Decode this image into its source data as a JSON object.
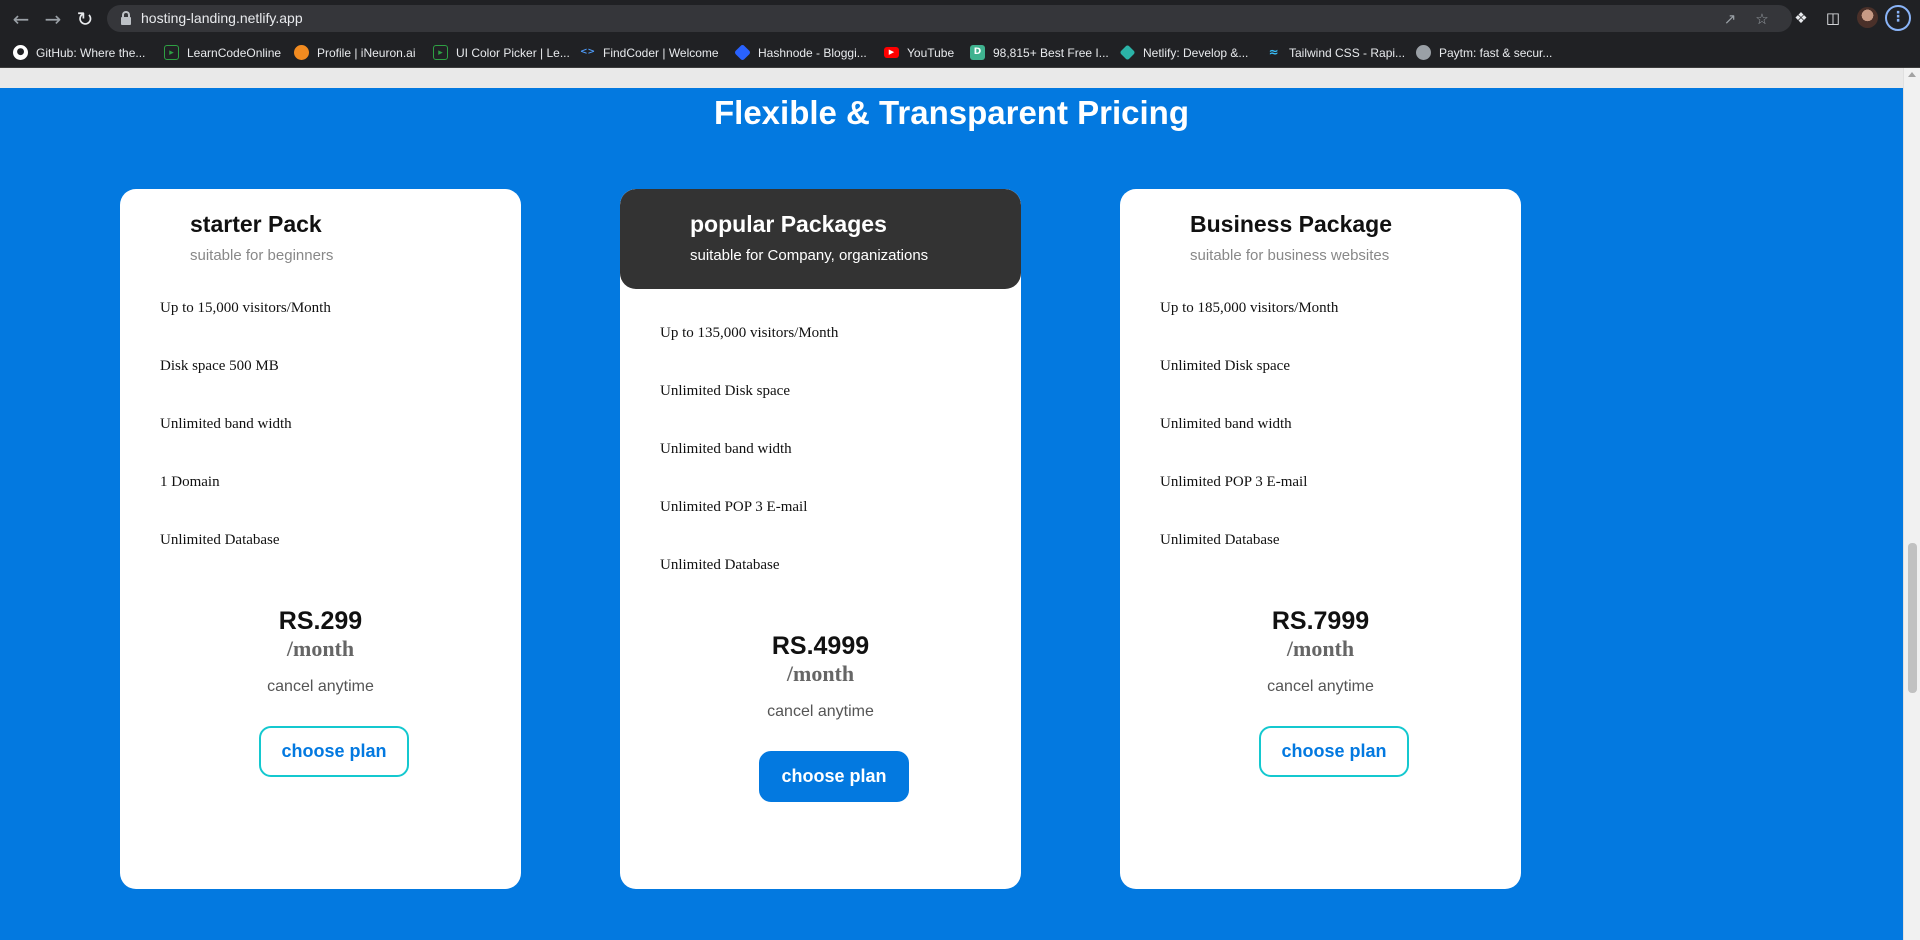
{
  "browser": {
    "url": "hosting-landing.netlify.app",
    "nav_icons": {
      "back": "arrow-left-icon",
      "forward": "arrow-right-icon",
      "reload": "reload-icon"
    },
    "bookmarks": [
      {
        "label": "GitHub: Where the...",
        "icon": "github-icon",
        "color": "#ffffff"
      },
      {
        "label": "LearnCodeOnline",
        "icon": "play-icon",
        "color": "#2ea043"
      },
      {
        "label": "Profile | iNeuron.ai",
        "icon": "ineuron-icon",
        "color": "#f28b20"
      },
      {
        "label": "UI Color Picker | Le...",
        "icon": "play-icon",
        "color": "#2ea043"
      },
      {
        "label": "FindCoder | Welcome",
        "icon": "code-icon",
        "color": "#4f9cf9"
      },
      {
        "label": "Hashnode - Bloggi...",
        "icon": "hashnode-icon",
        "color": "#2962ff"
      },
      {
        "label": "YouTube",
        "icon": "youtube-icon",
        "color": "#ff0000"
      },
      {
        "label": "98,815+ Best Free I...",
        "icon": "d-icon",
        "color": "#3fb28f"
      },
      {
        "label": "Netlify: Develop &...",
        "icon": "netlify-icon",
        "color": "#2bb3a7"
      },
      {
        "label": "Tailwind CSS - Rapi...",
        "icon": "tailwind-icon",
        "color": "#38bdf8"
      },
      {
        "label": "Paytm: fast & secur...",
        "icon": "globe-icon",
        "color": "#9aa0a6"
      }
    ]
  },
  "page": {
    "title": "Flexible & Transparent Pricing",
    "accent_color": "#0379e0",
    "plans": [
      {
        "name": "starter Pack",
        "subtitle": "suitable for beginners",
        "features": [
          "Up to 15,000 visitors/Month",
          "Disk space 500 MB",
          "Unlimited band width",
          "1 Domain",
          "Unlimited Database"
        ],
        "price": "RS.299",
        "period": "/month",
        "note": "cancel anytime",
        "cta": "choose plan"
      },
      {
        "name": "popular Packages",
        "subtitle": "suitable for Company, organizations",
        "features": [
          "Up to 135,000 visitors/Month",
          "Unlimited Disk space",
          "Unlimited band width",
          "Unlimited POP 3 E-mail",
          "Unlimited Database"
        ],
        "price": "RS.4999",
        "period": "/month",
        "note": "cancel anytime",
        "cta": "choose plan"
      },
      {
        "name": "Business Package",
        "subtitle": "suitable for business websites",
        "features": [
          "Up to 185,000 visitors/Month",
          "Unlimited Disk space",
          "Unlimited band width",
          "Unlimited POP 3 E-mail",
          "Unlimited Database"
        ],
        "price": "RS.7999",
        "period": "/month",
        "note": "cancel anytime",
        "cta": "choose plan"
      }
    ]
  }
}
